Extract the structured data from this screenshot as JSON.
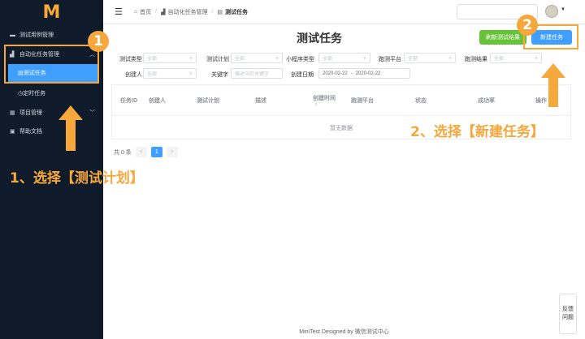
{
  "logo": "M",
  "sidebar": {
    "items": [
      {
        "icon": "folder-icon",
        "label": "测试用例管理"
      },
      {
        "icon": "chart-icon",
        "label": "自动化任务管理"
      },
      {
        "icon": "book-icon",
        "label": "测试任务"
      },
      {
        "icon": "clock-icon",
        "label": "定时任务"
      },
      {
        "icon": "grid-icon",
        "label": "项目管理"
      },
      {
        "icon": "doc-icon",
        "label": "帮助文档"
      }
    ]
  },
  "header": {
    "breadcrumb": [
      "首页",
      "自动化任务管理",
      "测试任务"
    ]
  },
  "main": {
    "title": "测试任务",
    "refresh_button": "刷新测试结果",
    "new_button": "新建任务",
    "filters": [
      {
        "label": "测试类型",
        "placeholder": "全部"
      },
      {
        "label": "测试计划",
        "placeholder": "全部"
      },
      {
        "label": "小程序类型",
        "placeholder": "全部"
      },
      {
        "label": "跑测平台",
        "placeholder": "全部"
      },
      {
        "label": "跑测结果",
        "placeholder": "全部"
      },
      {
        "label": "创建人",
        "placeholder": "全部"
      },
      {
        "label": "关键字",
        "placeholder": "描述中的关键字"
      },
      {
        "label": "创建日期",
        "start": "2020-02-22",
        "end": "2020-02-22"
      }
    ],
    "table": {
      "columns": [
        "任务ID",
        "创建人",
        "测试计划",
        "描述",
        "创建时间",
        "跑测平台",
        "状态",
        "成功率",
        "操作"
      ],
      "empty_text": "暂无数据"
    },
    "pager": {
      "total": "共 0 条",
      "prev": "<",
      "page": "1",
      "next": ">"
    }
  },
  "footer": "MiniTest Designed by 微信测试中心",
  "feedback": "反馈问题",
  "annotations": {
    "badge1": "1",
    "badge2": "2",
    "step1": "1、选择【测试计划】",
    "step2": "2、选择【新建任务】"
  },
  "colors": {
    "accent": "#409eff",
    "success": "#67c23a",
    "annotation": "#f7a83d",
    "sidebar": "#0f1b2b"
  }
}
